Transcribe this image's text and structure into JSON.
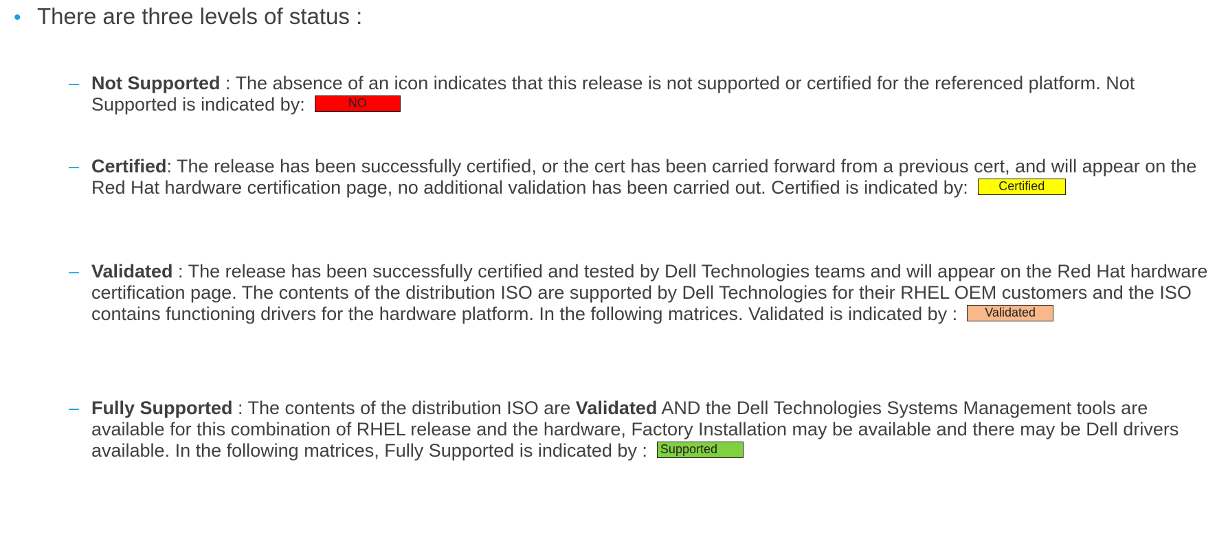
{
  "heading": "There are three levels of status :",
  "items": [
    {
      "term": "Not Supported",
      "sep": " : ",
      "body_parts": [
        "The absence of an icon indicates that this release is not supported or certified for the referenced platform. Not Supported is indicated by:"
      ],
      "badge": "NO"
    },
    {
      "term": "Certified",
      "sep": ": ",
      "body_parts": [
        "The release has been successfully certified, or the cert has been carried forward from a previous cert, and will appear on the Red Hat hardware certification page, no additional validation has been carried out. Certified is indicated by:"
      ],
      "badge": "Certified"
    },
    {
      "term": "Validated",
      "sep": " : ",
      "body_parts": [
        "The release has been successfully certified and tested by Dell Technologies teams and will appear on the Red Hat hardware certification page. The contents of the distribution ISO are supported by Dell Technologies for their RHEL OEM customers and the ISO contains functioning drivers for the hardware platform. In the following matrices. Validated is indicated by :"
      ],
      "badge": "Validated"
    },
    {
      "term": "Fully Supported",
      "sep": " : ",
      "body_before": "The contents of the distribution ISO are ",
      "body_bold": "Validated",
      "body_after": " AND the Dell Technologies Systems Management tools are available for this combination of RHEL release and the hardware, Factory Installation may be available and there may be Dell drivers available. In the following matrices, Fully Supported is indicated by :",
      "badge": "Supported"
    }
  ],
  "colors": {
    "bullet": "#1ba1e2",
    "text": "#404040",
    "no": "#ff0000",
    "certified": "#ffff00",
    "validated": "#f8b88b",
    "supported": "#80d040"
  }
}
